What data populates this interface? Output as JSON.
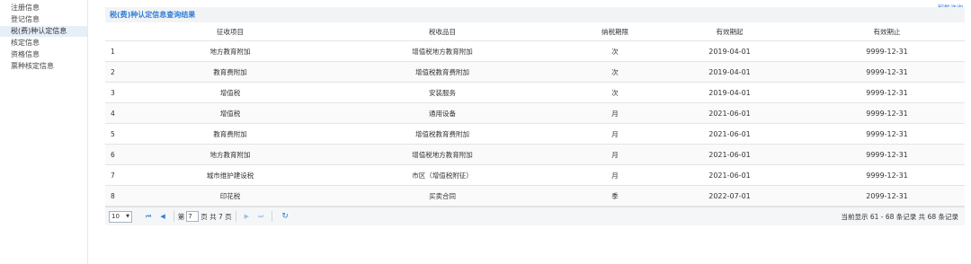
{
  "sidebar": {
    "items": [
      {
        "label": "注册信息",
        "active": false
      },
      {
        "label": "登记信息",
        "active": false
      },
      {
        "label": "税(费)种认定信息",
        "active": true
      },
      {
        "label": "核定信息",
        "active": false
      },
      {
        "label": "资格信息",
        "active": false
      },
      {
        "label": "票种核定信息",
        "active": false
      }
    ]
  },
  "top_right": {
    "help_label": "智能咨询"
  },
  "panel": {
    "title": "税(费)种认定信息查询结果"
  },
  "table": {
    "headers": [
      "",
      "征收项目",
      "税收品目",
      "纳税期限",
      "有效期起",
      "有效期止"
    ],
    "rows": [
      [
        "1",
        "地方教育附加",
        "增值税地方教育附加",
        "次",
        "2019-04-01",
        "9999-12-31"
      ],
      [
        "2",
        "教育费附加",
        "增值税教育费附加",
        "次",
        "2019-04-01",
        "9999-12-31"
      ],
      [
        "3",
        "增值税",
        "安装服务",
        "次",
        "2019-04-01",
        "9999-12-31"
      ],
      [
        "4",
        "增值税",
        "通用设备",
        "月",
        "2021-06-01",
        "9999-12-31"
      ],
      [
        "5",
        "教育费附加",
        "增值税教育费附加",
        "月",
        "2021-06-01",
        "9999-12-31"
      ],
      [
        "6",
        "地方教育附加",
        "增值税地方教育附加",
        "月",
        "2021-06-01",
        "9999-12-31"
      ],
      [
        "7",
        "城市维护建设税",
        "市区（增值税附征）",
        "月",
        "2021-06-01",
        "9999-12-31"
      ],
      [
        "8",
        "印花税",
        "买卖合同",
        "季",
        "2022-07-01",
        "2099-12-31"
      ]
    ]
  },
  "pager": {
    "page_size": "10",
    "page_prefix": "第",
    "current_page": "7",
    "page_suffix": "页 共 7 页",
    "summary": "当前显示 61 - 68 条记录 共 68 条记录"
  },
  "colors": {
    "accent": "#2f7ed8",
    "active_bg": "#e6eef8",
    "header_bg": "#f2f3f5"
  }
}
